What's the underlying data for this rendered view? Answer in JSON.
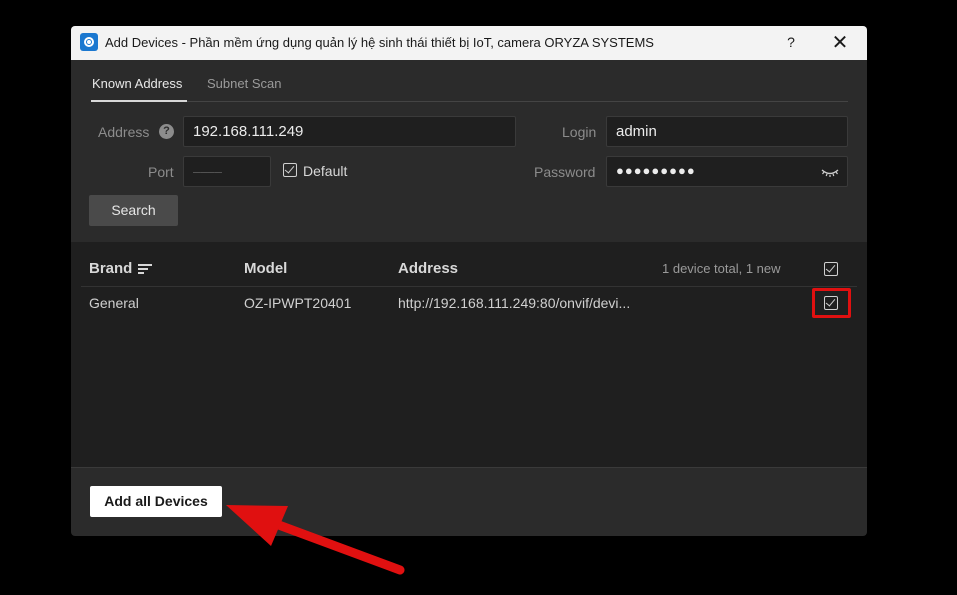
{
  "window": {
    "title": "Add Devices - Phần mềm ứng dụng quản lý hệ sinh thái thiết bị IoT, camera ORYZA SYSTEMS",
    "help_label": "?",
    "close_label": "✕"
  },
  "tabs": [
    {
      "label": "Known Address",
      "active": true
    },
    {
      "label": "Subnet Scan",
      "active": false
    }
  ],
  "form": {
    "address_label": "Address",
    "address_help": "?",
    "address_value": "192.168.111.249",
    "port_label": "Port",
    "port_placeholder": "––––",
    "default_label": "Default",
    "default_checked": true,
    "login_label": "Login",
    "login_value": "admin",
    "password_label": "Password",
    "password_value": "●●●●●●●●●",
    "search_label": "Search"
  },
  "table": {
    "columns": [
      "Brand",
      "Model",
      "Address"
    ],
    "summary": "1 device total, 1 new",
    "select_all_checked": true,
    "rows": [
      {
        "brand": "General",
        "model": "OZ-IPWPT20401",
        "address": "http://192.168.111.249:80/onvif/devi...",
        "checked": true
      }
    ]
  },
  "footer": {
    "add_all_label": "Add all Devices"
  },
  "colors": {
    "accent_highlight": "#e01010",
    "dialog_bg": "#2b2b2b",
    "table_bg": "#1f1f1f"
  }
}
